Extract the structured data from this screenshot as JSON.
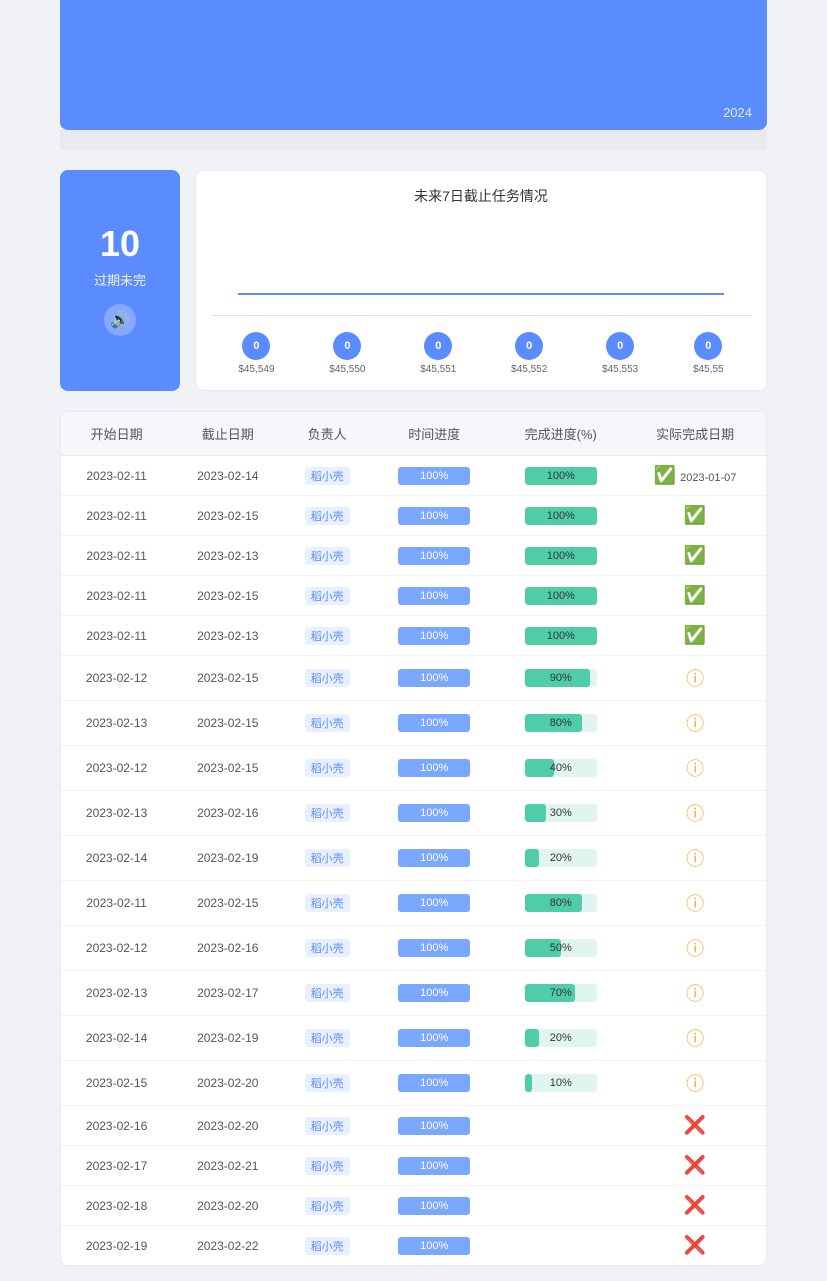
{
  "header": {
    "year": "2024",
    "banner_height": 130
  },
  "left_panel": {
    "count": "10",
    "label": "过期未完",
    "sound_icon": "🔊"
  },
  "chart": {
    "title": "未来7日截止任务情况",
    "points": [
      {
        "value": "0",
        "date": "$45,549"
      },
      {
        "value": "0",
        "date": "$45,550"
      },
      {
        "value": "0",
        "date": "$45,551"
      },
      {
        "value": "0",
        "date": "$45,552"
      },
      {
        "value": "0",
        "date": "$45,553"
      },
      {
        "value": "0",
        "date": "$45,55"
      }
    ]
  },
  "table": {
    "headers": [
      "开始日期",
      "截止日期",
      "负责人",
      "时间进度",
      "完成进度(%)",
      "实际完成日期"
    ],
    "rows": [
      {
        "start": "2023-02-11",
        "end": "2023-02-14",
        "person": "稻小壳",
        "time_pct": 100,
        "completion_pct": 100,
        "status": "green",
        "actual": "2023-01-07"
      },
      {
        "start": "2023-02-11",
        "end": "2023-02-15",
        "person": "稻小壳",
        "time_pct": 100,
        "completion_pct": 100,
        "status": "green",
        "actual": ""
      },
      {
        "start": "2023-02-11",
        "end": "2023-02-13",
        "person": "稻小壳",
        "time_pct": 100,
        "completion_pct": 100,
        "status": "green",
        "actual": ""
      },
      {
        "start": "2023-02-11",
        "end": "2023-02-15",
        "person": "稻小壳",
        "time_pct": 100,
        "completion_pct": 100,
        "status": "green",
        "actual": ""
      },
      {
        "start": "2023-02-11",
        "end": "2023-02-13",
        "person": "稻小壳",
        "time_pct": 100,
        "completion_pct": 100,
        "status": "green",
        "actual": ""
      },
      {
        "start": "2023-02-12",
        "end": "2023-02-15",
        "person": "稻小壳",
        "time_pct": 100,
        "completion_pct": 90,
        "status": "orange",
        "actual": ""
      },
      {
        "start": "2023-02-13",
        "end": "2023-02-15",
        "person": "稻小壳",
        "time_pct": 100,
        "completion_pct": 80,
        "status": "orange",
        "actual": ""
      },
      {
        "start": "2023-02-12",
        "end": "2023-02-15",
        "person": "稻小壳",
        "time_pct": 100,
        "completion_pct": 40,
        "status": "orange",
        "actual": ""
      },
      {
        "start": "2023-02-13",
        "end": "2023-02-16",
        "person": "稻小壳",
        "time_pct": 100,
        "completion_pct": 30,
        "status": "orange",
        "actual": ""
      },
      {
        "start": "2023-02-14",
        "end": "2023-02-19",
        "person": "稻小壳",
        "time_pct": 100,
        "completion_pct": 20,
        "status": "orange",
        "actual": ""
      },
      {
        "start": "2023-02-11",
        "end": "2023-02-15",
        "person": "稻小壳",
        "time_pct": 100,
        "completion_pct": 80,
        "status": "orange",
        "actual": ""
      },
      {
        "start": "2023-02-12",
        "end": "2023-02-16",
        "person": "稻小壳",
        "time_pct": 100,
        "completion_pct": 50,
        "status": "orange",
        "actual": ""
      },
      {
        "start": "2023-02-13",
        "end": "2023-02-17",
        "person": "稻小壳",
        "time_pct": 100,
        "completion_pct": 70,
        "status": "orange",
        "actual": ""
      },
      {
        "start": "2023-02-14",
        "end": "2023-02-19",
        "person": "稻小壳",
        "time_pct": 100,
        "completion_pct": 20,
        "status": "orange",
        "actual": ""
      },
      {
        "start": "2023-02-15",
        "end": "2023-02-20",
        "person": "稻小壳",
        "time_pct": 100,
        "completion_pct": 10,
        "status": "orange",
        "actual": ""
      },
      {
        "start": "2023-02-16",
        "end": "2023-02-20",
        "person": "稻小壳",
        "time_pct": 100,
        "completion_pct": 0,
        "status": "red",
        "actual": ""
      },
      {
        "start": "2023-02-17",
        "end": "2023-02-21",
        "person": "稻小壳",
        "time_pct": 100,
        "completion_pct": 0,
        "status": "red",
        "actual": ""
      },
      {
        "start": "2023-02-18",
        "end": "2023-02-20",
        "person": "稻小壳",
        "time_pct": 100,
        "completion_pct": 0,
        "status": "red",
        "actual": ""
      },
      {
        "start": "2023-02-19",
        "end": "2023-02-22",
        "person": "稻小壳",
        "time_pct": 100,
        "completion_pct": 0,
        "status": "red",
        "actual": ""
      }
    ]
  }
}
